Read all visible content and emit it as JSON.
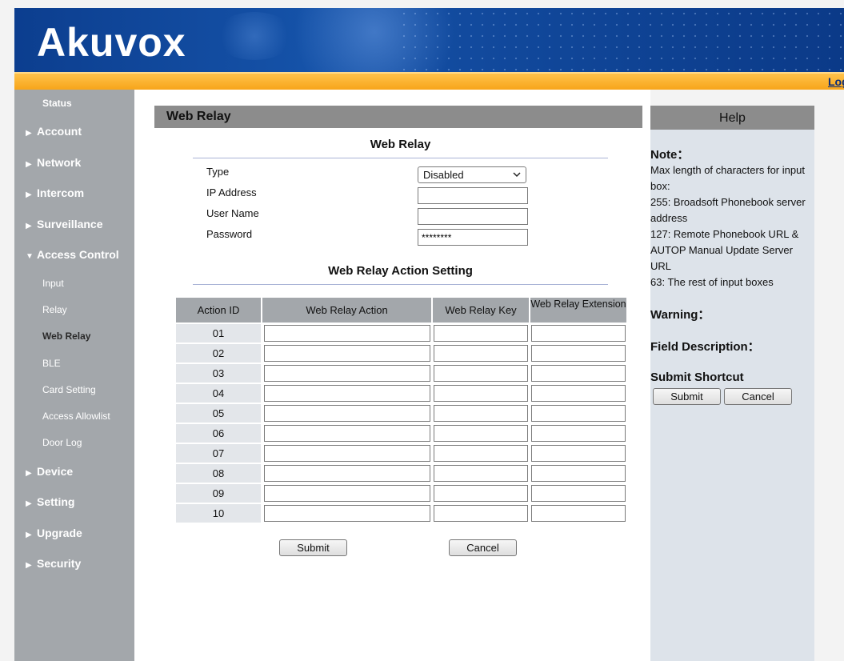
{
  "brand": {
    "logo_text": "Akuvox",
    "logout_label": "Logout"
  },
  "sidebar": {
    "status": "Status",
    "items": [
      {
        "label": "Account",
        "expanded": false
      },
      {
        "label": "Network",
        "expanded": false
      },
      {
        "label": "Intercom",
        "expanded": false
      },
      {
        "label": "Surveillance",
        "expanded": false
      },
      {
        "label": "Access Control",
        "expanded": true
      },
      {
        "label": "Device",
        "expanded": false
      },
      {
        "label": "Setting",
        "expanded": false
      },
      {
        "label": "Upgrade",
        "expanded": false
      },
      {
        "label": "Security",
        "expanded": false
      }
    ],
    "access_control_sub": [
      "Input",
      "Relay",
      "Web Relay",
      "BLE",
      "Card Setting",
      "Access Allowlist",
      "Door Log"
    ],
    "active_sub": "Web Relay",
    "collapsed_arrow": "▶",
    "expanded_arrow": "▼"
  },
  "main": {
    "header": "Web Relay",
    "web_relay": {
      "title": "Web Relay",
      "type_label": "Type",
      "type_value": "Disabled",
      "ip_label": "IP Address",
      "ip_value": "",
      "user_label": "User Name",
      "user_value": "",
      "password_label": "Password",
      "password_value": "********"
    },
    "action_setting": {
      "title": "Web Relay Action Setting",
      "columns": [
        "Action ID",
        "Web Relay Action",
        "Web Relay Key",
        "Web Relay Extension"
      ],
      "rows": [
        "01",
        "02",
        "03",
        "04",
        "05",
        "06",
        "07",
        "08",
        "09",
        "10"
      ]
    },
    "submit_label": "Submit",
    "cancel_label": "Cancel"
  },
  "help": {
    "header": "Help",
    "note_title": "Note：",
    "note_lines": [
      "Max length of characters for input box:",
      "255: Broadsoft Phonebook server address",
      "127: Remote Phonebook URL & AUTOP Manual Update Server URL",
      "63: The rest of input boxes"
    ],
    "warning_title": "Warning：",
    "field_desc_title": "Field Description：",
    "shortcut_title": "Submit Shortcut",
    "submit_label": "Submit",
    "cancel_label": "Cancel"
  },
  "colors": {
    "banner_blue": "#1552a8",
    "orange_bar": "#f7a51a",
    "sidebar_gray": "#a3a7ab",
    "header_gray": "#8c8c8c",
    "help_bg": "#dde3ea"
  }
}
